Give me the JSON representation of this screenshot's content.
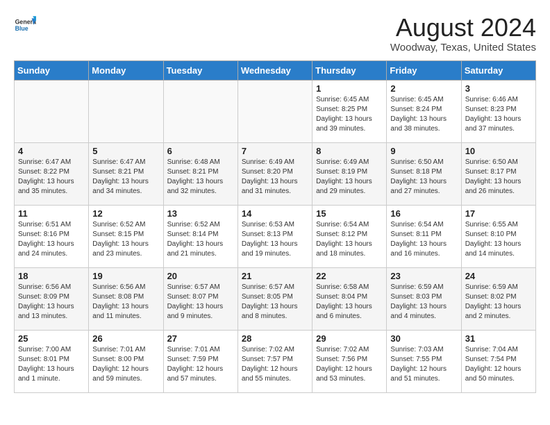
{
  "header": {
    "logo_general": "General",
    "logo_blue": "Blue",
    "title": "August 2024",
    "subtitle": "Woodway, Texas, United States"
  },
  "weekdays": [
    "Sunday",
    "Monday",
    "Tuesday",
    "Wednesday",
    "Thursday",
    "Friday",
    "Saturday"
  ],
  "weeks": [
    [
      {
        "day": "",
        "info": ""
      },
      {
        "day": "",
        "info": ""
      },
      {
        "day": "",
        "info": ""
      },
      {
        "day": "",
        "info": ""
      },
      {
        "day": "1",
        "info": "Sunrise: 6:45 AM\nSunset: 8:25 PM\nDaylight: 13 hours\nand 39 minutes."
      },
      {
        "day": "2",
        "info": "Sunrise: 6:45 AM\nSunset: 8:24 PM\nDaylight: 13 hours\nand 38 minutes."
      },
      {
        "day": "3",
        "info": "Sunrise: 6:46 AM\nSunset: 8:23 PM\nDaylight: 13 hours\nand 37 minutes."
      }
    ],
    [
      {
        "day": "4",
        "info": "Sunrise: 6:47 AM\nSunset: 8:22 PM\nDaylight: 13 hours\nand 35 minutes."
      },
      {
        "day": "5",
        "info": "Sunrise: 6:47 AM\nSunset: 8:21 PM\nDaylight: 13 hours\nand 34 minutes."
      },
      {
        "day": "6",
        "info": "Sunrise: 6:48 AM\nSunset: 8:21 PM\nDaylight: 13 hours\nand 32 minutes."
      },
      {
        "day": "7",
        "info": "Sunrise: 6:49 AM\nSunset: 8:20 PM\nDaylight: 13 hours\nand 31 minutes."
      },
      {
        "day": "8",
        "info": "Sunrise: 6:49 AM\nSunset: 8:19 PM\nDaylight: 13 hours\nand 29 minutes."
      },
      {
        "day": "9",
        "info": "Sunrise: 6:50 AM\nSunset: 8:18 PM\nDaylight: 13 hours\nand 27 minutes."
      },
      {
        "day": "10",
        "info": "Sunrise: 6:50 AM\nSunset: 8:17 PM\nDaylight: 13 hours\nand 26 minutes."
      }
    ],
    [
      {
        "day": "11",
        "info": "Sunrise: 6:51 AM\nSunset: 8:16 PM\nDaylight: 13 hours\nand 24 minutes."
      },
      {
        "day": "12",
        "info": "Sunrise: 6:52 AM\nSunset: 8:15 PM\nDaylight: 13 hours\nand 23 minutes."
      },
      {
        "day": "13",
        "info": "Sunrise: 6:52 AM\nSunset: 8:14 PM\nDaylight: 13 hours\nand 21 minutes."
      },
      {
        "day": "14",
        "info": "Sunrise: 6:53 AM\nSunset: 8:13 PM\nDaylight: 13 hours\nand 19 minutes."
      },
      {
        "day": "15",
        "info": "Sunrise: 6:54 AM\nSunset: 8:12 PM\nDaylight: 13 hours\nand 18 minutes."
      },
      {
        "day": "16",
        "info": "Sunrise: 6:54 AM\nSunset: 8:11 PM\nDaylight: 13 hours\nand 16 minutes."
      },
      {
        "day": "17",
        "info": "Sunrise: 6:55 AM\nSunset: 8:10 PM\nDaylight: 13 hours\nand 14 minutes."
      }
    ],
    [
      {
        "day": "18",
        "info": "Sunrise: 6:56 AM\nSunset: 8:09 PM\nDaylight: 13 hours\nand 13 minutes."
      },
      {
        "day": "19",
        "info": "Sunrise: 6:56 AM\nSunset: 8:08 PM\nDaylight: 13 hours\nand 11 minutes."
      },
      {
        "day": "20",
        "info": "Sunrise: 6:57 AM\nSunset: 8:07 PM\nDaylight: 13 hours\nand 9 minutes."
      },
      {
        "day": "21",
        "info": "Sunrise: 6:57 AM\nSunset: 8:05 PM\nDaylight: 13 hours\nand 8 minutes."
      },
      {
        "day": "22",
        "info": "Sunrise: 6:58 AM\nSunset: 8:04 PM\nDaylight: 13 hours\nand 6 minutes."
      },
      {
        "day": "23",
        "info": "Sunrise: 6:59 AM\nSunset: 8:03 PM\nDaylight: 13 hours\nand 4 minutes."
      },
      {
        "day": "24",
        "info": "Sunrise: 6:59 AM\nSunset: 8:02 PM\nDaylight: 13 hours\nand 2 minutes."
      }
    ],
    [
      {
        "day": "25",
        "info": "Sunrise: 7:00 AM\nSunset: 8:01 PM\nDaylight: 13 hours\nand 1 minute."
      },
      {
        "day": "26",
        "info": "Sunrise: 7:01 AM\nSunset: 8:00 PM\nDaylight: 12 hours\nand 59 minutes."
      },
      {
        "day": "27",
        "info": "Sunrise: 7:01 AM\nSunset: 7:59 PM\nDaylight: 12 hours\nand 57 minutes."
      },
      {
        "day": "28",
        "info": "Sunrise: 7:02 AM\nSunset: 7:57 PM\nDaylight: 12 hours\nand 55 minutes."
      },
      {
        "day": "29",
        "info": "Sunrise: 7:02 AM\nSunset: 7:56 PM\nDaylight: 12 hours\nand 53 minutes."
      },
      {
        "day": "30",
        "info": "Sunrise: 7:03 AM\nSunset: 7:55 PM\nDaylight: 12 hours\nand 51 minutes."
      },
      {
        "day": "31",
        "info": "Sunrise: 7:04 AM\nSunset: 7:54 PM\nDaylight: 12 hours\nand 50 minutes."
      }
    ]
  ]
}
